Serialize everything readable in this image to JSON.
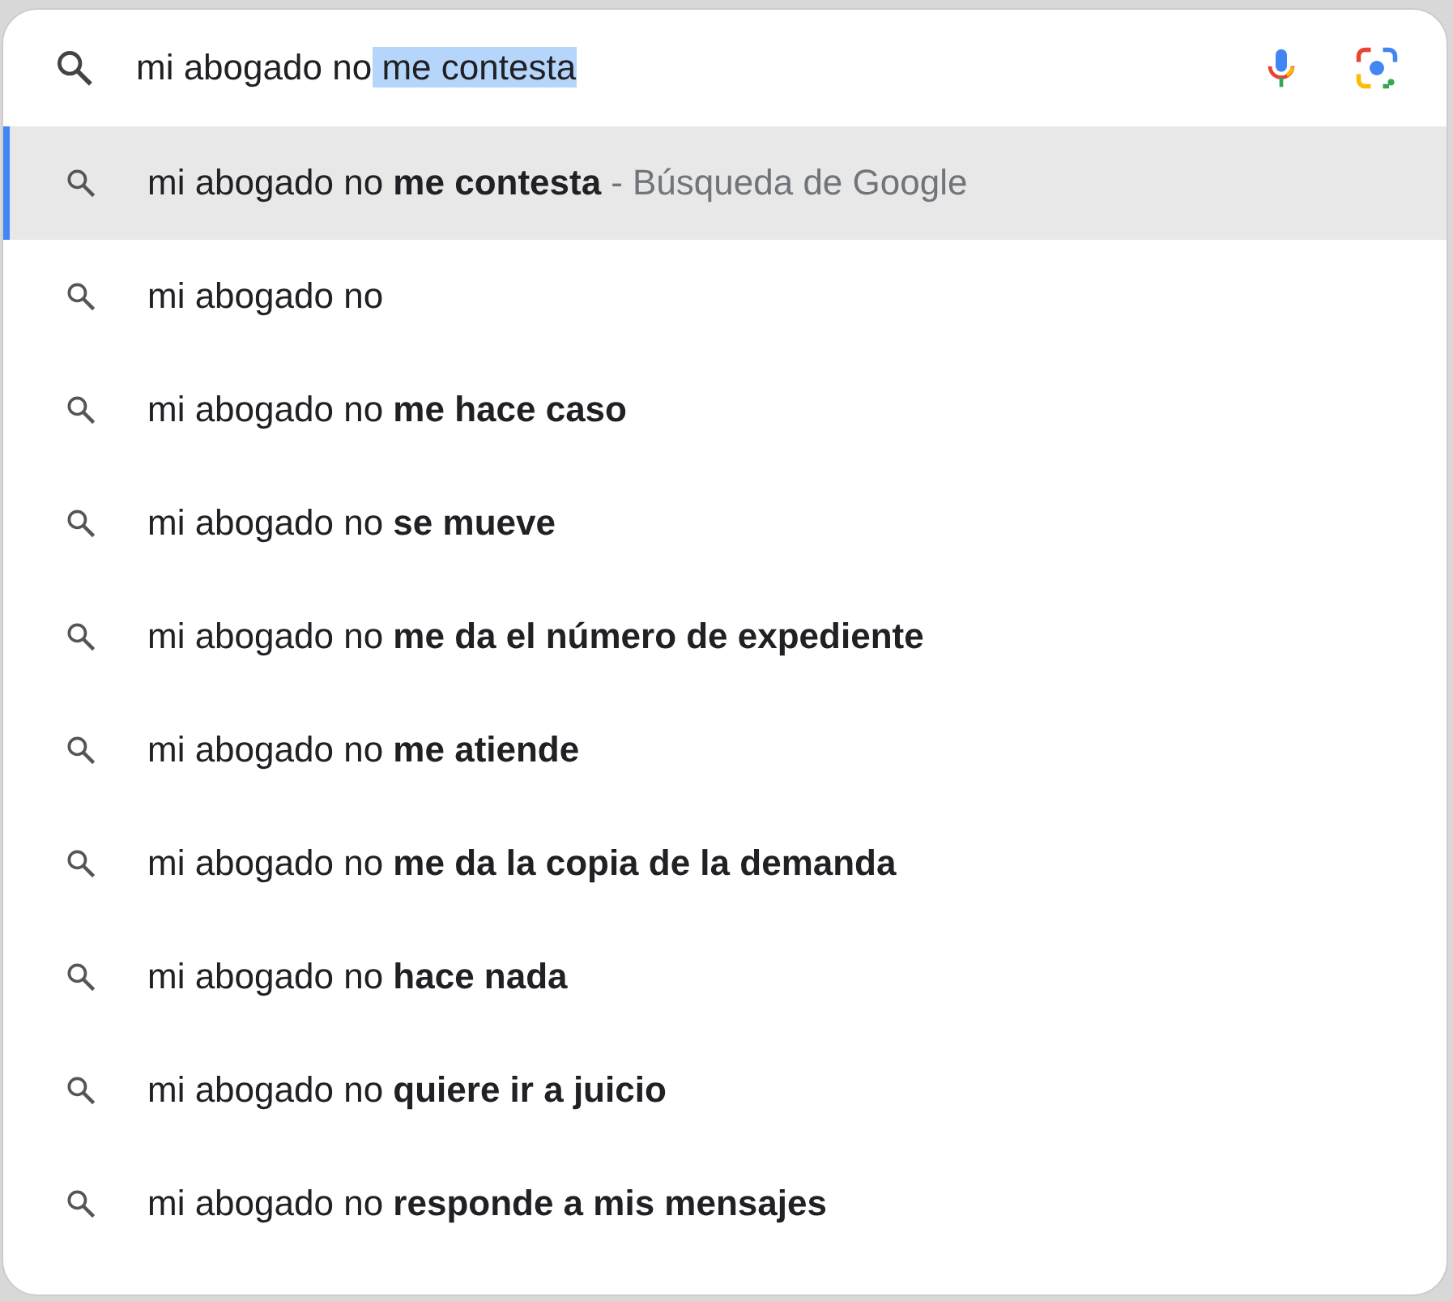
{
  "search": {
    "typed_text": "mi abogado no",
    "selected_text": "me contesta"
  },
  "suggestions": [
    {
      "text": "mi abogado no **me contesta**",
      "suffix": "- Búsqueda de Google",
      "selected": true
    },
    {
      "text": "mi abogado no",
      "selected": false
    },
    {
      "text": "mi abogado no **me hace caso**",
      "selected": false
    },
    {
      "text": "mi abogado no **se mueve**",
      "selected": false
    },
    {
      "text": "mi abogado no **me da el número de expediente**",
      "selected": false
    },
    {
      "text": "mi abogado no **me atiende**",
      "selected": false
    },
    {
      "text": "mi abogado no **me da la copia de la demanda**",
      "selected": false
    },
    {
      "text": "mi abogado no **hace nada**",
      "selected": false
    },
    {
      "text": "mi abogado no **quiere ir a juicio**",
      "selected": false
    },
    {
      "text": "mi abogado no **responde a mis mensajes**",
      "selected": false
    }
  ]
}
